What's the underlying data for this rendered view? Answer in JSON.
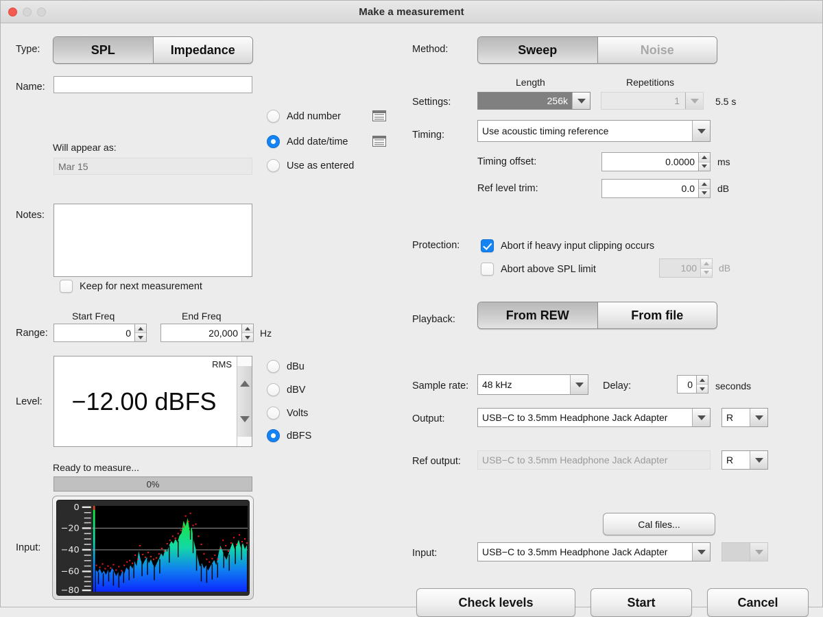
{
  "window": {
    "title": "Make a measurement",
    "traffic_lights": [
      "close",
      "minimize",
      "maximize"
    ]
  },
  "left": {
    "type": {
      "label": "Type:",
      "options": [
        "SPL",
        "Impedance"
      ],
      "selected": "SPL"
    },
    "name": {
      "label": "Name:",
      "value": "",
      "placeholder": ""
    },
    "will_appear_as": {
      "label": "Will appear as:",
      "value": "Mar 15"
    },
    "naming_options": [
      {
        "label": "Add number",
        "selected": false
      },
      {
        "label": "Add date/time",
        "selected": true
      },
      {
        "label": "Use as entered",
        "selected": false
      }
    ],
    "notes": {
      "label": "Notes:",
      "value": "",
      "keep_label": "Keep for next measurement",
      "keep_checked": false
    },
    "range": {
      "label": "Range:",
      "start_header": "Start Freq",
      "end_header": "End Freq",
      "start_value": "0",
      "end_value": "20,000",
      "unit": "Hz"
    },
    "level": {
      "label": "Level:",
      "mode": "RMS",
      "value": "−12.00 dBFS",
      "units": [
        {
          "label": "dBu",
          "selected": false
        },
        {
          "label": "dBV",
          "selected": false
        },
        {
          "label": "Volts",
          "selected": false
        },
        {
          "label": "dBFS",
          "selected": true
        }
      ]
    },
    "status": {
      "text": "Ready to measure...",
      "progress_label": "0%",
      "progress_percent": 0
    },
    "input_meter": {
      "label": "Input:",
      "axis_labels": [
        "0",
        "−20",
        "−40",
        "−60",
        "−80"
      ],
      "axis_min": -80,
      "axis_max": 0,
      "gridlines": [
        -20,
        -40
      ]
    }
  },
  "right": {
    "method": {
      "label": "Method:",
      "options": [
        "Sweep",
        "Noise"
      ],
      "selected": "Sweep",
      "disabled_option": "Noise"
    },
    "settings": {
      "label": "Settings:",
      "length_header": "Length",
      "repetitions_header": "Repetitions",
      "length_value": "256k",
      "repetitions_value": "1",
      "duration": "5.5 s"
    },
    "timing": {
      "label": "Timing:",
      "value": "Use acoustic timing reference",
      "offset_label": "Timing offset:",
      "offset_value": "0.0000",
      "offset_unit": "ms",
      "trim_label": "Ref level trim:",
      "trim_value": "0.0",
      "trim_unit": "dB"
    },
    "protection": {
      "label": "Protection:",
      "clip_label": "Abort if heavy input clipping occurs",
      "clip_checked": true,
      "spl_label": "Abort above SPL limit",
      "spl_checked": false,
      "spl_value": "100",
      "spl_unit": "dB"
    },
    "playback": {
      "label": "Playback:",
      "options": [
        "From REW",
        "From file"
      ],
      "selected": "From REW"
    },
    "sample_rate": {
      "label": "Sample rate:",
      "value": "48 kHz"
    },
    "delay": {
      "label": "Delay:",
      "value": "0",
      "unit": "seconds"
    },
    "output": {
      "label": "Output:",
      "device": "USB−C to 3.5mm Headphone Jack Adapter",
      "channel": "R"
    },
    "ref_output": {
      "label": "Ref output:",
      "device": "USB−C to 3.5mm Headphone Jack Adapter",
      "channel": "R"
    },
    "cal_files_button": "Cal files...",
    "input": {
      "label": "Input:",
      "device": "USB−C to 3.5mm Headphone Jack Adapter",
      "channel": ""
    },
    "buttons": {
      "check_levels": "Check levels",
      "start": "Start",
      "cancel": "Cancel"
    }
  },
  "colors": {
    "accent": "#1683f5",
    "close": "#f15b50",
    "meter_low": "#0b28ff",
    "meter_high": "#18e830",
    "peak_dot": "#ff1a1a"
  }
}
